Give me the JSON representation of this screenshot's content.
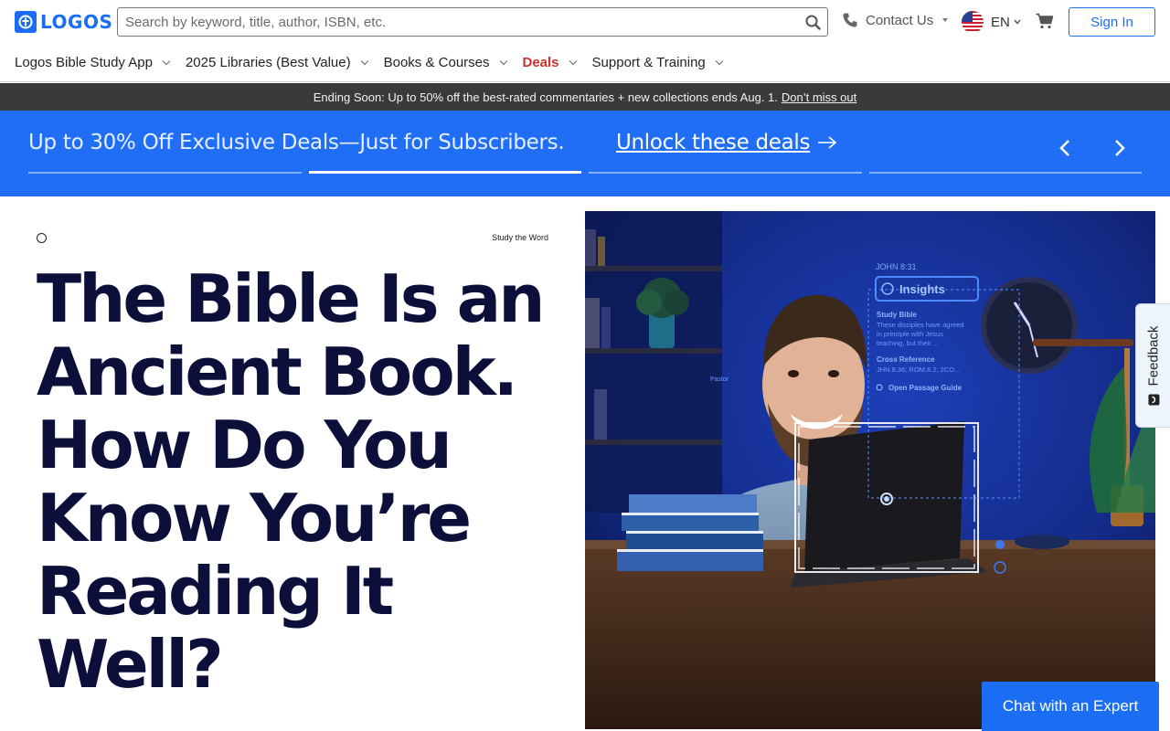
{
  "header": {
    "logo_text": "LOGOS",
    "search_placeholder": "Search by keyword, title, author, ISBN, etc.",
    "contact_label": "Contact Us",
    "language_label": "EN",
    "signin_label": "Sign In"
  },
  "nav": {
    "items": [
      {
        "label": "Logos Bible Study App"
      },
      {
        "label": "2025 Libraries (Best Value)"
      },
      {
        "label": "Books & Courses"
      },
      {
        "label": "Deals"
      },
      {
        "label": "Support & Training"
      }
    ]
  },
  "promo": {
    "text": "Ending Soon: Up to 50% off the best-rated commentaries + new collections ends Aug. 1.",
    "link": "Don’t miss out"
  },
  "banner": {
    "text": "Up to 30% Off Exclusive Deals—Just for Subscribers.",
    "link": "Unlock these deals",
    "active_slide": 2,
    "slide_count": 4
  },
  "hero": {
    "eyebrow": "Study the Word",
    "headline": "The Bible Is an Ancient Book. How Do You Know You’re Reading It Well?"
  },
  "hero_image": {
    "verse": "JOHN 8:31",
    "insights": "Insights",
    "study_bible_title": "Study Bible",
    "study_bible_text": [
      "These disciples have agreed",
      "in principle with Jesus",
      "teaching, but their ..."
    ],
    "cross_ref_title": "Cross Reference",
    "cross_ref_text": "JHN.8.36; ROM.8.2; 2CO...",
    "guide": "Open Passage Guide",
    "speaker_tag": "Pastor"
  },
  "feedback_label": "Feedback",
  "chat_label": "Chat with an Expert",
  "colors": {
    "brand_blue": "#1b6ef3",
    "banner_blue": "#1f6ef5",
    "deals_red": "#c9302c",
    "headline_navy": "#0b0f3a",
    "promo_dark": "#3a3a3a"
  },
  "icons": [
    "logos-logo-icon",
    "search-icon",
    "phone-icon",
    "us-flag-icon",
    "cart-icon",
    "chevron-down-icon",
    "arrow-right-icon",
    "chevron-left-icon",
    "chevron-right-icon",
    "feedback-icon"
  ]
}
